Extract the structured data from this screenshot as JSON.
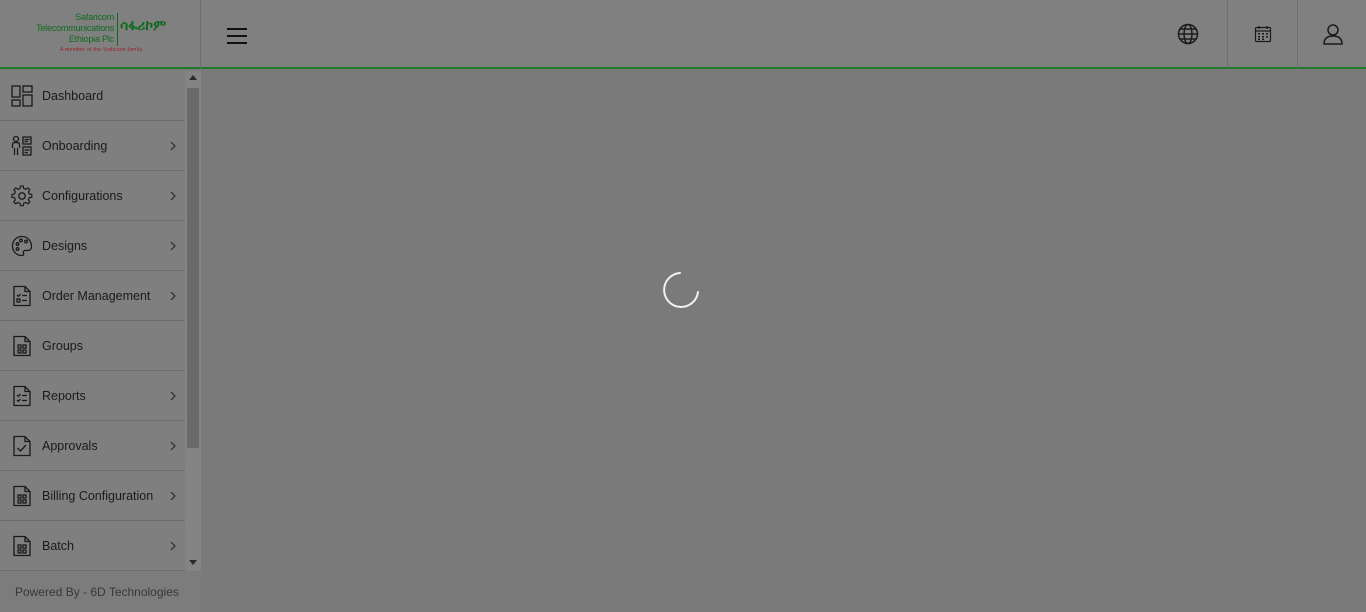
{
  "logo": {
    "company_line1": "Safaricom",
    "company_line2": "Telecommunications",
    "company_line3": "Ethiopia Plc",
    "amharic": "ሳፋሪኮም",
    "tagline": "A member of the Vodacom family"
  },
  "header": {
    "menu_icon": "hamburger-icon",
    "icons": [
      "globe-icon",
      "calendar-icon",
      "user-icon"
    ]
  },
  "sidebar": {
    "items": [
      {
        "label": "Dashboard",
        "icon": "dashboard-icon",
        "has_submenu": false
      },
      {
        "label": "Onboarding",
        "icon": "onboarding-icon",
        "has_submenu": true
      },
      {
        "label": "Configurations",
        "icon": "gear-icon",
        "has_submenu": true
      },
      {
        "label": "Designs",
        "icon": "palette-icon",
        "has_submenu": true
      },
      {
        "label": "Order Management",
        "icon": "order-document-icon",
        "has_submenu": true
      },
      {
        "label": "Groups",
        "icon": "groups-document-icon",
        "has_submenu": false
      },
      {
        "label": "Reports",
        "icon": "report-document-icon",
        "has_submenu": true
      },
      {
        "label": "Approvals",
        "icon": "approval-check-icon",
        "has_submenu": true
      },
      {
        "label": "Billing Configuration",
        "icon": "billing-document-icon",
        "has_submenu": true
      },
      {
        "label": "Batch",
        "icon": "batch-document-icon",
        "has_submenu": true
      }
    ]
  },
  "footer": {
    "text": "Powered By - 6D Technologies"
  },
  "colors": {
    "brand_green": "#0e6a1c",
    "header_border": "#1f7a2a",
    "overlay_gray": "#7a7a7a"
  }
}
